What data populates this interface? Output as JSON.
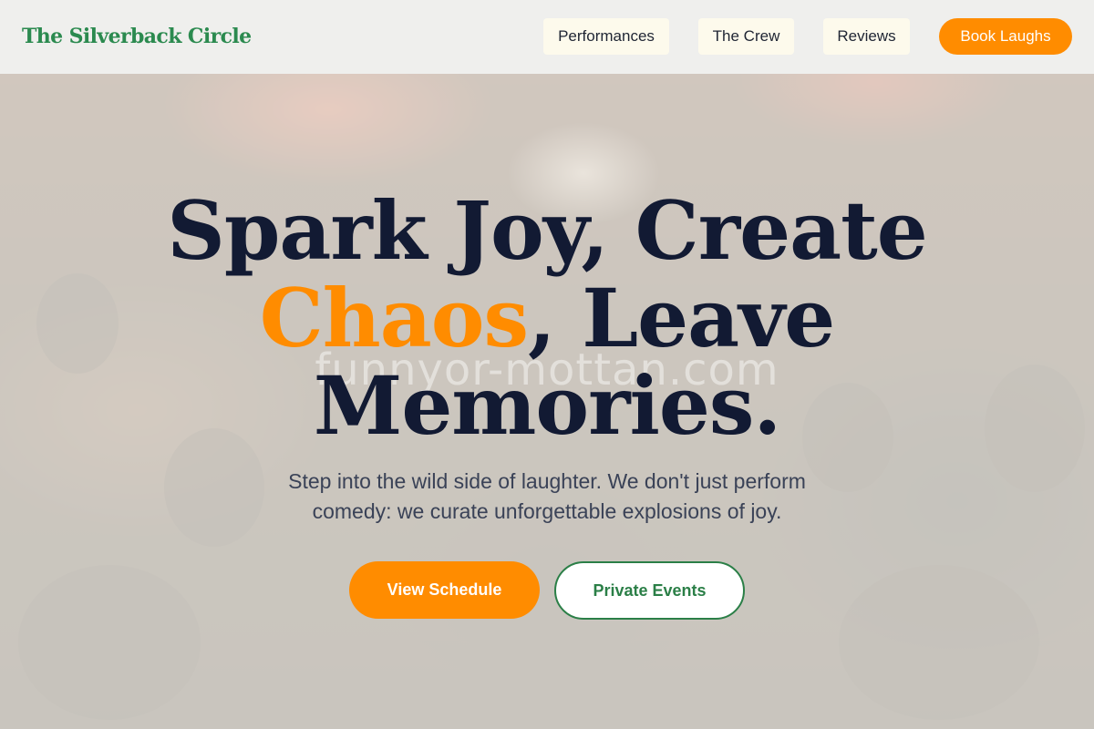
{
  "brand": {
    "name": "The Silverback Circle"
  },
  "nav": {
    "items": [
      {
        "label": "Performances"
      },
      {
        "label": "The Crew"
      },
      {
        "label": "Reviews"
      }
    ],
    "cta_label": "Book Laughs"
  },
  "hero": {
    "headline_line1": "Spark Joy, Create",
    "headline_accent": "Chaos",
    "headline_line2_rest": ", Leave",
    "headline_line3": "Memories.",
    "subtext": "Step into the wild side of laughter. We don't just perform comedy: we curate unforgettable explosions of joy.",
    "primary_cta": "View Schedule",
    "secondary_cta": "Private Events",
    "watermark": "funnyor-mottan.com"
  },
  "colors": {
    "brand_green": "#2b8a4f",
    "accent_orange": "#ff8c00",
    "headline_navy": "#121a33"
  }
}
